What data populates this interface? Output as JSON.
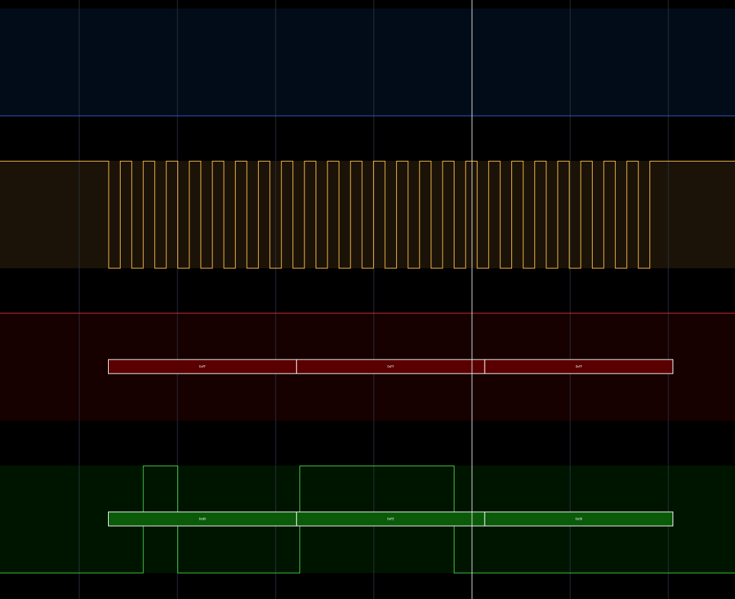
{
  "colors": {
    "background": "#000000",
    "grid": "#2a3140",
    "cursor": "#e8e8e8",
    "channel_1": "#3060c8",
    "channel_1_fill": "#020c19",
    "channel_2": "#ffc04a",
    "channel_2_fill": "#1c1308",
    "channel_3": "#e03030",
    "channel_3_fill": "#160000",
    "channel_3_box_fill": "#5a0000",
    "channel_4": "#44d044",
    "channel_4_fill": "#001500",
    "channel_4_box_fill": "#0a5a0a",
    "box_border": "#ffffff"
  },
  "channels": [
    {
      "id": "ch1",
      "signal": "flat-low"
    },
    {
      "id": "ch2",
      "signal": "clock",
      "clock_cycles": 24
    },
    {
      "id": "ch3",
      "signal": "decoded-bytes",
      "bytes": [
        "0xFF",
        "0xFF",
        "0xFF"
      ]
    },
    {
      "id": "ch4",
      "signal": "digital",
      "transitions_in_clock_cycles": [
        1.5,
        3.0,
        8.3,
        15.0
      ],
      "initial_level": "low",
      "bytes": [
        "0x60",
        "0xFE",
        "0x00"
      ]
    }
  ],
  "icons": {
    "cursor": "vertical-cursor-line"
  }
}
